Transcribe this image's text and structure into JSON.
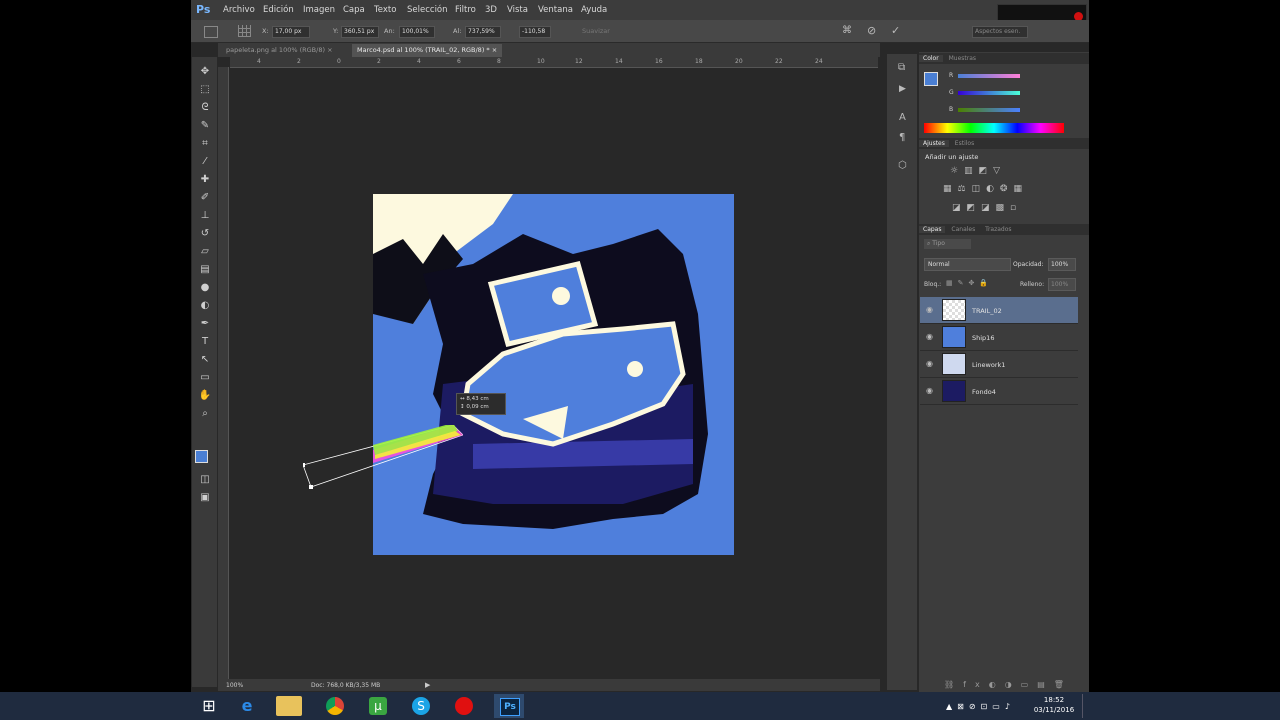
{
  "menubar": {
    "logo": "Ps",
    "items": [
      "Archivo",
      "Edición",
      "Imagen",
      "Capa",
      "Texto",
      "Selección",
      "Filtro",
      "3D",
      "Vista",
      "Ventana",
      "Ayuda"
    ]
  },
  "options": {
    "x_label": "X:",
    "x_value": "17,00 px",
    "y_label": "Y:",
    "y_value": "360,51 px",
    "w_label": "An:",
    "w_value": "100,01%",
    "h_label": "Al:",
    "h_value": "737,59%",
    "angle_value": "-110,58",
    "smooth_label": "Suavizar",
    "workspace": "Aspectos esen."
  },
  "tabs": [
    {
      "label": "papeleta.png al 100% (RGB/8)",
      "close": "×"
    },
    {
      "label": "Marco4.psd al 100% (TRAIL_02, RGB/8) *",
      "close": "×"
    }
  ],
  "ruler": [
    "4",
    "2",
    "0",
    "2",
    "4",
    "6",
    "8",
    "10",
    "12",
    "14",
    "16",
    "18",
    "20",
    "22",
    "24"
  ],
  "transform_hud": {
    "w": "8,43 cm",
    "h": "0,09 cm"
  },
  "status": {
    "zoom": "100%",
    "doc": "Doc: 768,0 KB/3,35 MB"
  },
  "panels": {
    "color_tabs": [
      "Color",
      "Muestras"
    ],
    "channels": [
      "R",
      "G",
      "B"
    ],
    "adjust_tabs": [
      "Ajustes",
      "Estilos"
    ],
    "adjust_title": "Añadir un ajuste",
    "layer_tabs": [
      "Capas",
      "Canales",
      "Trazados"
    ],
    "kind": "Tipo",
    "blend_mode": "Normal",
    "opacity_label": "Opacidad:",
    "opacity_value": "100%",
    "lock_label": "Bloq.:",
    "fill_label": "Relleno:",
    "fill_value": "100%"
  },
  "layers": [
    {
      "name": "TRAIL_02",
      "selected": true
    },
    {
      "name": "Ship16",
      "selected": false
    },
    {
      "name": "Linework1",
      "selected": false
    },
    {
      "name": "Fondo4",
      "selected": false
    }
  ],
  "taskbar": {
    "time": "18:52",
    "date": "03/11/2016"
  },
  "colors": {
    "foreground": "#4a7fd4",
    "artwork_bg": "#4f7fdc",
    "selected_layer": "#5a6e8e"
  }
}
